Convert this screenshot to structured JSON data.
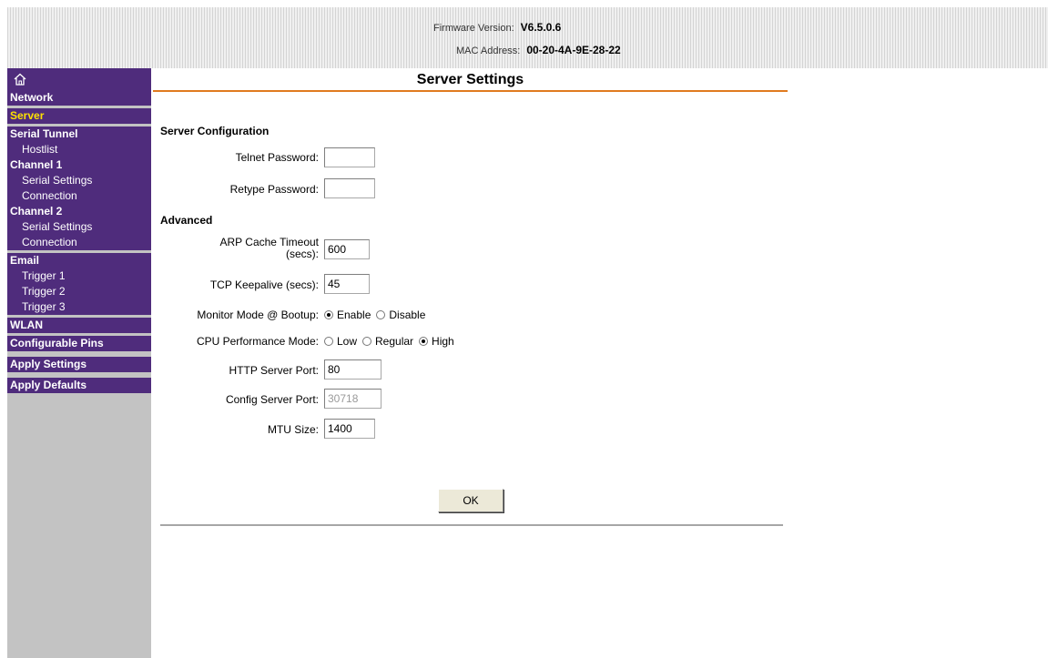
{
  "header": {
    "firmware_label": "Firmware Version:",
    "firmware_value": "V6.5.0.6",
    "mac_label": "MAC Address:",
    "mac_value": "00-20-4A-9E-28-22"
  },
  "sidebar": {
    "home_icon": "home-icon",
    "items": [
      {
        "label": "Network",
        "level": 0
      },
      {
        "label": "Server",
        "level": 0,
        "active": true
      },
      {
        "label": "Serial Tunnel",
        "level": 0
      },
      {
        "label": "Hostlist",
        "level": 1
      },
      {
        "label": "Channel 1",
        "level": 0
      },
      {
        "label": "Serial Settings",
        "level": 1
      },
      {
        "label": "Connection",
        "level": 1
      },
      {
        "label": "Channel 2",
        "level": 0
      },
      {
        "label": "Serial Settings",
        "level": 1
      },
      {
        "label": "Connection",
        "level": 1
      },
      {
        "label": "Email",
        "level": 0
      },
      {
        "label": "Trigger 1",
        "level": 1
      },
      {
        "label": "Trigger 2",
        "level": 1
      },
      {
        "label": "Trigger 3",
        "level": 1
      },
      {
        "label": "WLAN",
        "level": 0
      },
      {
        "label": "Configurable Pins",
        "level": 0
      },
      {
        "label": "Apply Settings",
        "level": 0
      },
      {
        "label": "Apply Defaults",
        "level": 0
      }
    ],
    "colors": {
      "menu_bg": "#4f2c7c",
      "active_text": "#ffe200",
      "panel_bg": "#c3c3c3"
    }
  },
  "main": {
    "title": "Server Settings",
    "accent_color": "#e07a1f",
    "server_config": {
      "heading": "Server Configuration",
      "telnet_password_label": "Telnet Password:",
      "telnet_password_value": "",
      "retype_password_label": "Retype Password:",
      "retype_password_value": ""
    },
    "advanced": {
      "heading": "Advanced",
      "arp_label_line1": "ARP Cache Timeout",
      "arp_label_line2": "(secs):",
      "arp_value": "600",
      "tcp_keepalive_label": "TCP Keepalive (secs):",
      "tcp_keepalive_value": "45",
      "monitor_mode_label": "Monitor Mode @ Bootup:",
      "monitor_mode_options": [
        "Enable",
        "Disable"
      ],
      "monitor_mode_selected": "Enable",
      "cpu_mode_label": "CPU Performance Mode:",
      "cpu_mode_options": [
        "Low",
        "Regular",
        "High"
      ],
      "cpu_mode_selected": "High",
      "http_port_label": "HTTP Server Port:",
      "http_port_value": "80",
      "config_port_label": "Config Server Port:",
      "config_port_value": "30718",
      "mtu_label": "MTU Size:",
      "mtu_value": "1400"
    },
    "ok_label": "OK"
  }
}
